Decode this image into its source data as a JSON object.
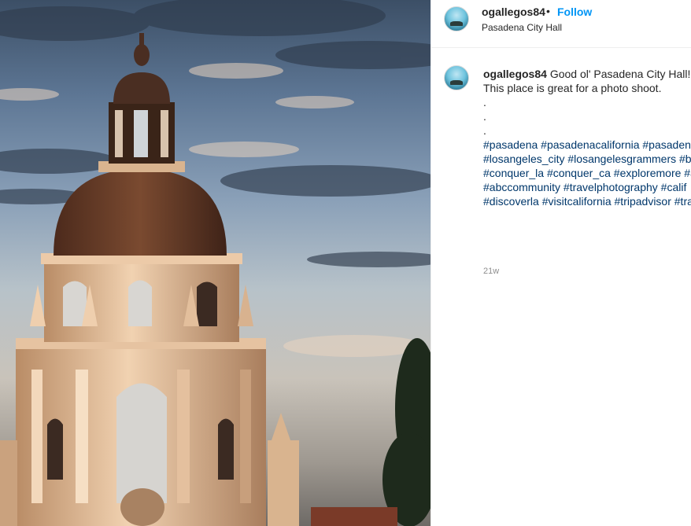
{
  "post": {
    "username": "ogallegos84",
    "separator": "•",
    "follow_label": "Follow",
    "location": "Pasadena City Hall"
  },
  "caption": {
    "username": "ogallegos84",
    "text_line1": "Good ol' Pasadena City Hall!",
    "text_line2": "This place is great for a photo shoot.",
    "dots": [
      ".",
      ".",
      "."
    ],
    "hashtag_lines": [
      "#pasadena #pasadenacalifornia #pasadena",
      "#losangeles_city #losangelesgrammers #be",
      "#conquer_la #conquer_ca #exploremore #a",
      "#abccommunity #travelphotography #calif",
      "#discoverla #visitcalifornia #tripadvisor #tra"
    ],
    "timestamp": "21w"
  },
  "colors": {
    "link_blue": "#0095f6",
    "hashtag": "#00376b",
    "muted": "#8e8e8e"
  },
  "icons": {
    "avatar": "avatar-beach-icon"
  }
}
